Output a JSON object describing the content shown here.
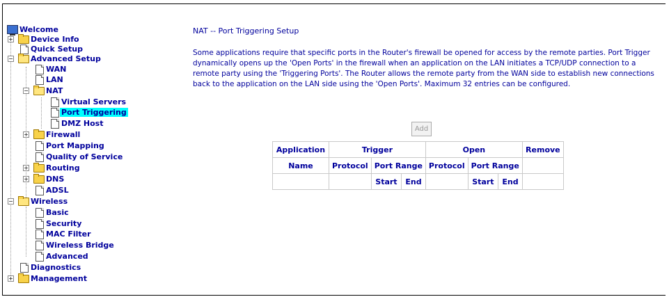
{
  "tree": {
    "welcome": "Welcome",
    "device_info": "Device Info",
    "quick_setup": "Quick Setup",
    "advanced_setup": "Advanced Setup",
    "wan": "WAN",
    "lan": "LAN",
    "nat": "NAT",
    "virtual_servers": "Virtual Servers",
    "port_triggering": "Port Triggering",
    "dmz_host": "DMZ Host",
    "firewall": "Firewall",
    "port_mapping": "Port Mapping",
    "qos": "Quality of Service",
    "routing": "Routing",
    "dns": "DNS",
    "adsl": "ADSL",
    "wireless": "Wireless",
    "basic": "Basic",
    "security": "Security",
    "mac_filter": "MAC Filter",
    "wireless_bridge": "Wireless Bridge",
    "advanced": "Advanced",
    "diagnostics": "Diagnostics",
    "management": "Management"
  },
  "icons": {
    "expand": "+",
    "collapse": "−"
  },
  "page": {
    "title": "NAT -- Port Triggering Setup",
    "description": "Some applications require that specific ports in the Router's firewall be opened for access by the remote parties. Port Trigger dynamically opens up the 'Open Ports' in the firewall when an application on the LAN initiates a TCP/UDP connection to a remote party using the 'Triggering Ports'. The Router allows the remote party from the WAN side to establish new connections back to the application on the LAN side using the 'Open Ports'. Maximum 32 entries can be configured.",
    "add_label": "Add"
  },
  "table": {
    "application": "Application",
    "trigger": "Trigger",
    "open": "Open",
    "remove": "Remove",
    "name": "Name",
    "protocol": "Protocol",
    "port_range": "Port Range",
    "start": "Start",
    "end": "End"
  },
  "colors": {
    "text": "#00009c",
    "selected_bg": "#00ffff",
    "border": "#c9c9c9"
  }
}
